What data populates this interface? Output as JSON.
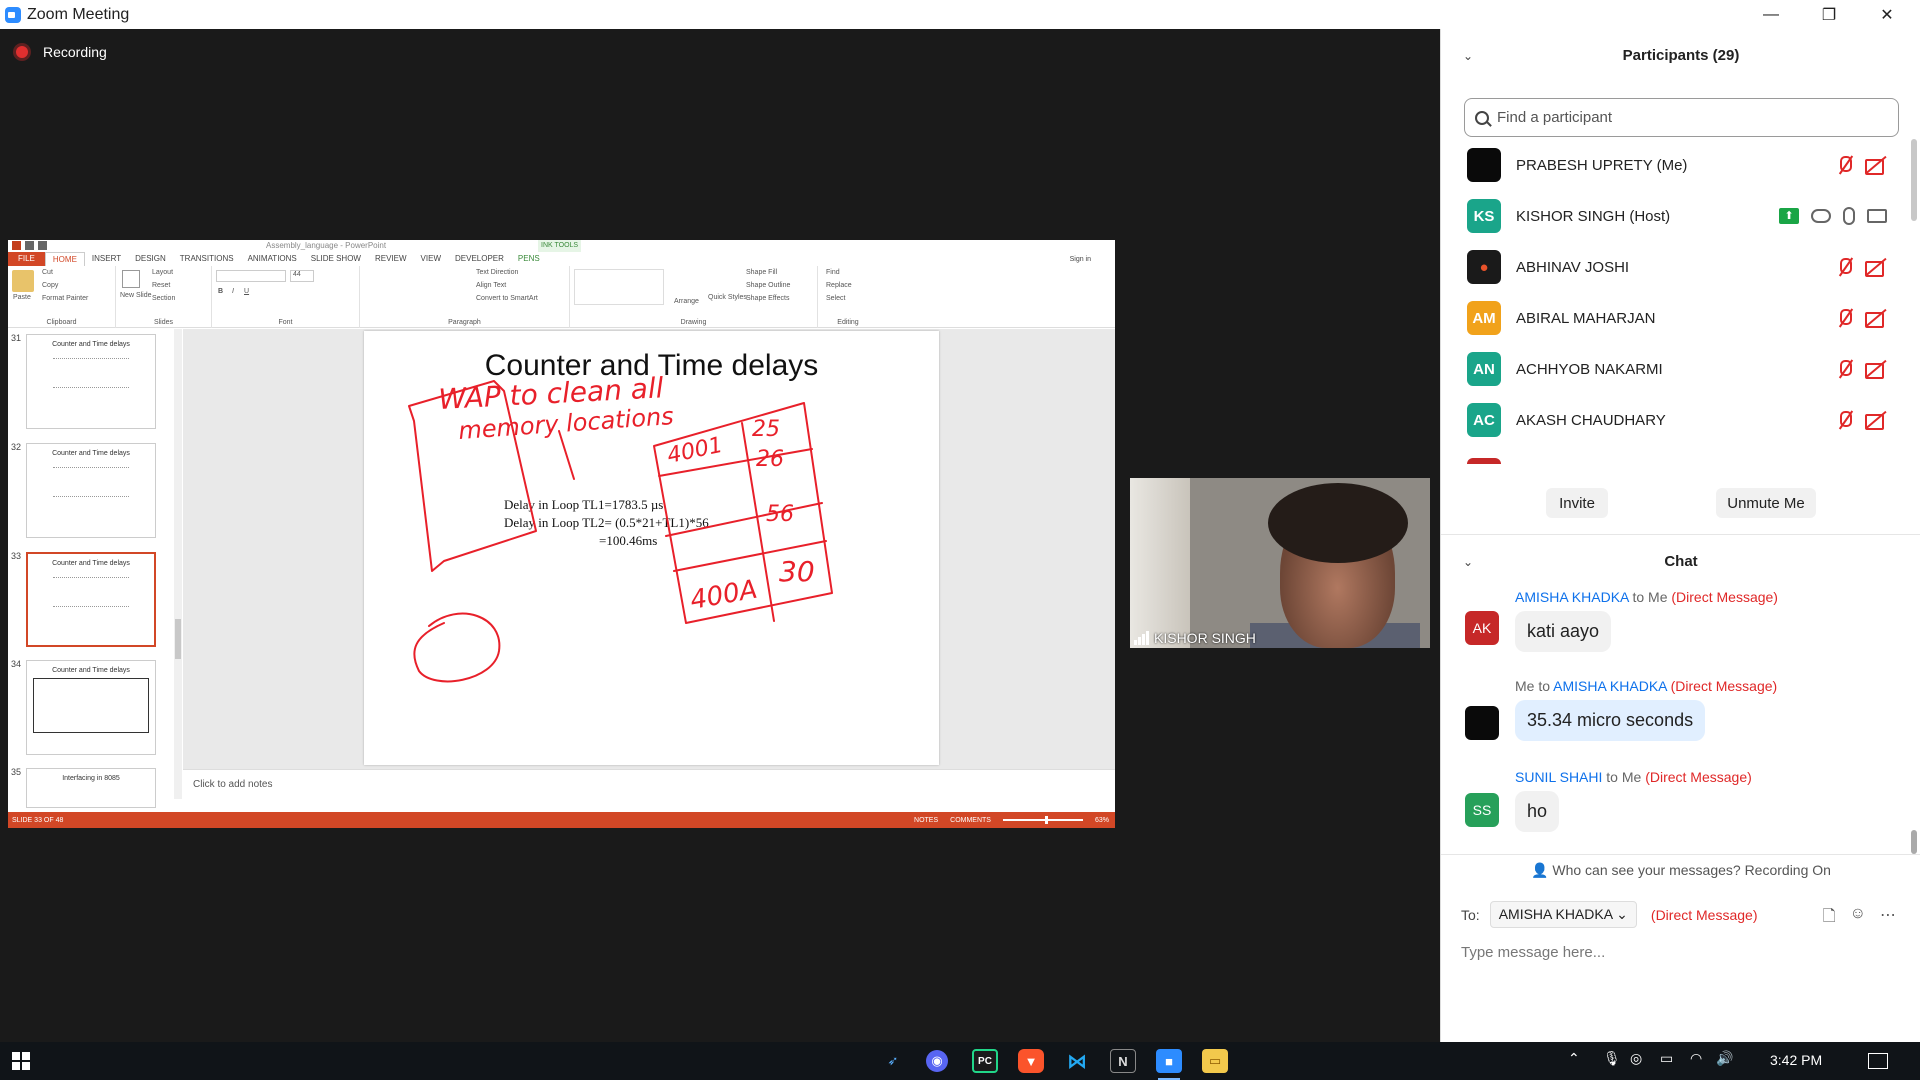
{
  "window": {
    "title": "Zoom Meeting",
    "minimize": "—",
    "restore": "❐",
    "close": "✕"
  },
  "recording": {
    "label": "Recording"
  },
  "powerpoint": {
    "doc_title": "Assembly_language - PowerPoint",
    "ink_tools": "INK TOOLS",
    "tabs": [
      "FILE",
      "HOME",
      "INSERT",
      "DESIGN",
      "TRANSITIONS",
      "ANIMATIONS",
      "SLIDE SHOW",
      "REVIEW",
      "VIEW",
      "DEVELOPER",
      "PENS"
    ],
    "sign_in": "Sign in",
    "ribbon": {
      "clipboard": {
        "label": "Clipboard",
        "paste": "Paste",
        "cut": "Cut",
        "copy": "Copy",
        "format_painter": "Format Painter"
      },
      "slides": {
        "label": "Slides",
        "new_slide": "New Slide",
        "layout": "Layout",
        "reset": "Reset",
        "section": "Section"
      },
      "font": {
        "label": "Font",
        "size": "44"
      },
      "paragraph": {
        "label": "Paragraph",
        "text_direction": "Text Direction",
        "align_text": "Align Text",
        "convert": "Convert to SmartArt"
      },
      "drawing": {
        "label": "Drawing",
        "arrange": "Arrange",
        "quick_styles": "Quick Styles",
        "shape_fill": "Shape Fill",
        "shape_outline": "Shape Outline",
        "shape_effects": "Shape Effects"
      },
      "editing": {
        "label": "Editing",
        "find": "Find",
        "replace": "Replace",
        "select": "Select"
      }
    },
    "thumbnails": [
      {
        "num": "31",
        "title": "Counter and Time delays"
      },
      {
        "num": "32",
        "title": "Counter and Time delays"
      },
      {
        "num": "33",
        "title": "Counter and Time delays"
      },
      {
        "num": "34",
        "title": "Counter and Time delays"
      },
      {
        "num": "35",
        "title": "Interfacing in 8085"
      }
    ],
    "slide": {
      "title": "Counter and Time delays",
      "lines": [
        "Delay in Loop TL1=1783.5 µs",
        "Delay in Loop TL2= (0.5*21+TL1)*56",
        "=100.46ms"
      ]
    },
    "ink_text": {
      "line1": "WAP to clean all",
      "line2": "memory locations"
    },
    "table_cells": [
      "4001",
      "25",
      "26",
      "56",
      "400A",
      "30"
    ],
    "notes": "Click to add notes",
    "status": {
      "slide": "SLIDE 33 OF 48",
      "notes": "NOTES",
      "comments": "COMMENTS",
      "zoom": "63%"
    }
  },
  "video": {
    "name": "KISHOR SINGH"
  },
  "participants": {
    "header": "Participants (29)",
    "search_placeholder": "Find a participant",
    "list": [
      {
        "initials": "",
        "name": "PRABESH UPRETY (Me)",
        "color": "#0a0a0a",
        "status": "muted"
      },
      {
        "initials": "KS",
        "name": "KISHOR SINGH (Host)",
        "color": "#1aa58a",
        "status": "host"
      },
      {
        "initials": "",
        "name": "ABHINAV JOSHI",
        "color": "#1a1a1a",
        "status": "muted"
      },
      {
        "initials": "AM",
        "name": "ABIRAL MAHARJAN",
        "color": "#f1a21b",
        "status": "muted"
      },
      {
        "initials": "AN",
        "name": "ACHHYOB NAKARMI",
        "color": "#1aa58a",
        "status": "muted"
      },
      {
        "initials": "AC",
        "name": "AKASH CHAUDHARY",
        "color": "#1aa58a",
        "status": "muted"
      }
    ],
    "invite": "Invite",
    "unmute": "Unmute Me"
  },
  "chat": {
    "header": "Chat",
    "messages": [
      {
        "initials": "AK",
        "avatar_color": "#c62828",
        "sender": "AMISHA KHADKA",
        "to": " to Me ",
        "dm": "(Direct Message)",
        "text": "kati aayo"
      },
      {
        "initials": "",
        "avatar_color": "#0a0a0a",
        "sender_prefix": "Me to ",
        "sender": "AMISHA KHADKA",
        "dm": " (Direct Message)",
        "text": "35.34 micro seconds"
      },
      {
        "initials": "SS",
        "avatar_color": "#27a05a",
        "sender": "SUNIL SHAHI",
        "to": " to Me ",
        "dm": "(Direct Message)",
        "text": "ho"
      }
    ],
    "who_can_see": "Who can see your messages? Recording On",
    "to_label": "To:",
    "recipient": "AMISHA KHADKA",
    "dm_label": "(Direct Message)",
    "input_placeholder": "Type message here..."
  },
  "taskbar": {
    "time": "3:42 PM"
  }
}
